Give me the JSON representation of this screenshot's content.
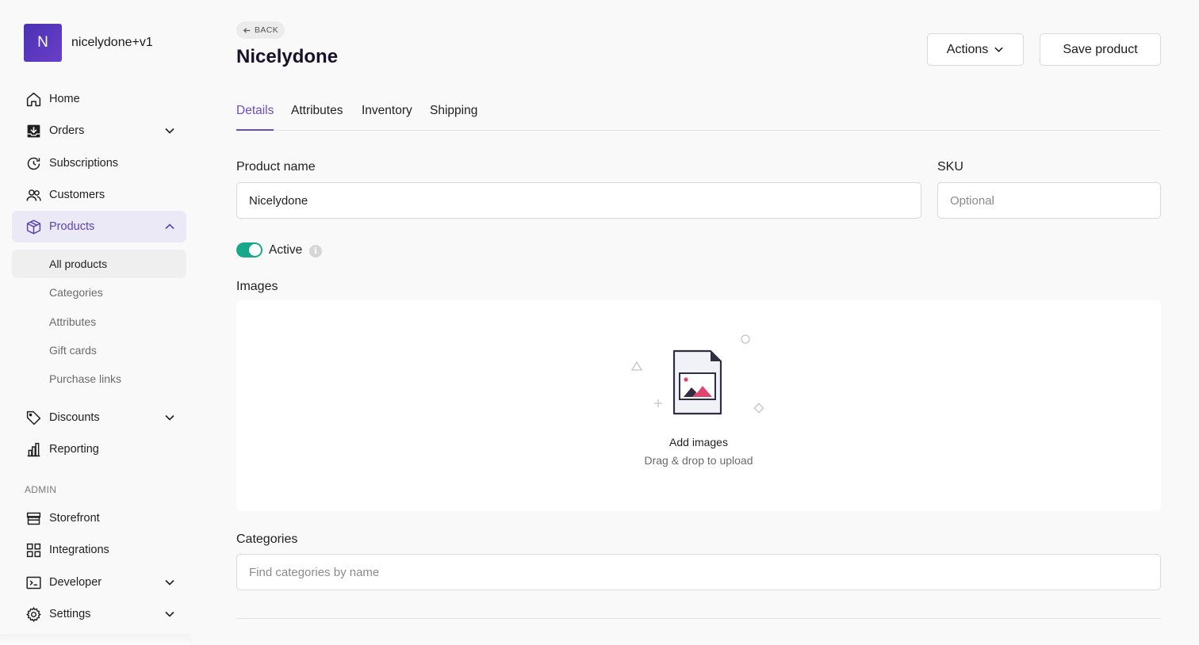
{
  "store": {
    "initial": "N",
    "name": "nicelydone+v1"
  },
  "nav": {
    "home": "Home",
    "orders": "Orders",
    "subscriptions": "Subscriptions",
    "customers": "Customers",
    "products": "Products",
    "products_sub": [
      "All products",
      "Categories",
      "Attributes",
      "Gift cards",
      "Purchase links"
    ],
    "discounts": "Discounts",
    "reporting": "Reporting",
    "admin_label": "ADMIN",
    "storefront": "Storefront",
    "integrations": "Integrations",
    "developer": "Developer",
    "settings": "Settings"
  },
  "header": {
    "back_label": "BACK",
    "title": "Nicelydone",
    "actions_label": "Actions",
    "save_label": "Save product"
  },
  "tabs": [
    "Details",
    "Attributes",
    "Inventory",
    "Shipping"
  ],
  "form": {
    "product_name_label": "Product name",
    "product_name_value": "Nicelydone",
    "sku_label": "SKU",
    "sku_placeholder": "Optional",
    "active_label": "Active",
    "active": true,
    "info_glyph": "i",
    "images_label": "Images",
    "add_images": "Add images",
    "drag_drop": "Drag & drop to upload",
    "categories_label": "Categories",
    "categories_placeholder": "Find categories by name"
  },
  "colors": {
    "accent": "#6a4fbf",
    "toggle_on": "#17a88c",
    "brand_avatar": "#4a32b5",
    "image_accent": "#e0456f"
  }
}
